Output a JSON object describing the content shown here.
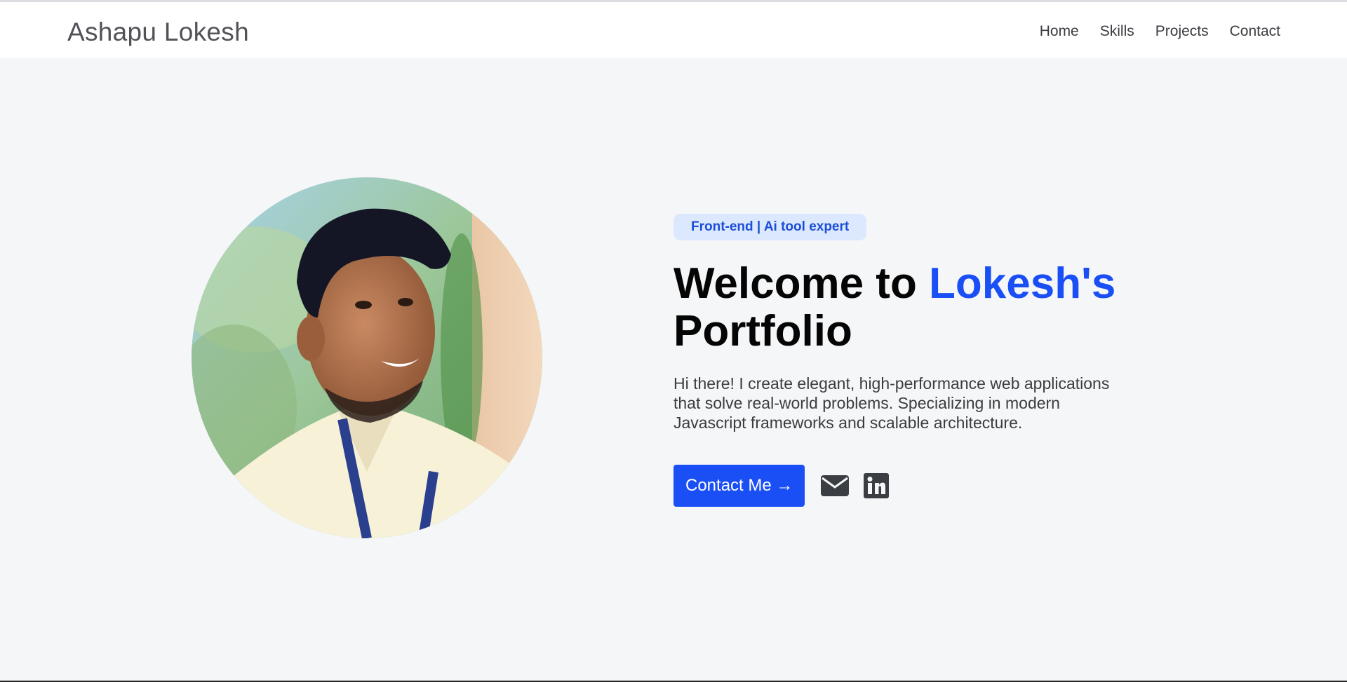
{
  "nav": {
    "brand": "Ashapu Lokesh",
    "links": [
      "Home",
      "Skills",
      "Projects",
      "Contact"
    ]
  },
  "hero": {
    "badge": "Front-end | Ai tool expert",
    "heading_prefix": "Welcome to",
    "heading_highlight": "Lokesh's",
    "heading_suffix": "Portfolio",
    "description": "Hi there! I create elegant, high-performance web applications that solve real-world problems. Specializing in modern Javascript frameworks and scalable architecture.",
    "cta_label": "Contact Me →",
    "social_icons": [
      "envelope-icon",
      "linkedin-icon"
    ],
    "photo": "profile-photo"
  },
  "colors": {
    "accent": "#1a4ff5",
    "badge_bg": "#dbe8fd",
    "badge_text": "#1d4ed8",
    "hero_bg": "#f5f6f8"
  }
}
